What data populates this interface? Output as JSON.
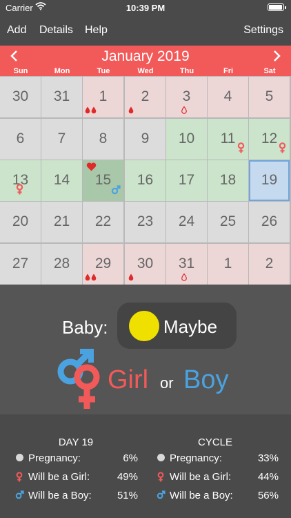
{
  "status_bar": {
    "carrier": "Carrier",
    "time": "10:39 PM"
  },
  "nav": {
    "add": "Add",
    "details": "Details",
    "help": "Help",
    "settings": "Settings"
  },
  "calendar": {
    "month_title": "January 2019",
    "weekdays": [
      "Sun",
      "Mon",
      "Tue",
      "Wed",
      "Thu",
      "Fri",
      "Sat"
    ],
    "days": [
      {
        "n": "30",
        "t": "other"
      },
      {
        "n": "31",
        "t": "other"
      },
      {
        "n": "1",
        "t": "period",
        "flow": 2
      },
      {
        "n": "2",
        "t": "period",
        "flow": 1
      },
      {
        "n": "3",
        "t": "period",
        "flow": "light"
      },
      {
        "n": "4",
        "t": "period"
      },
      {
        "n": "5",
        "t": "period"
      },
      {
        "n": "6",
        "t": "other"
      },
      {
        "n": "7",
        "t": "other"
      },
      {
        "n": "8",
        "t": "other"
      },
      {
        "n": "9",
        "t": "other"
      },
      {
        "n": "10",
        "t": "fertile"
      },
      {
        "n": "11",
        "t": "fertile",
        "sex": "girl"
      },
      {
        "n": "12",
        "t": "fertile",
        "sex": "girl"
      },
      {
        "n": "13",
        "t": "fertile",
        "sex": "girl"
      },
      {
        "n": "14",
        "t": "fertile"
      },
      {
        "n": "15",
        "t": "ovulation",
        "sex": "boy",
        "heart": true
      },
      {
        "n": "16",
        "t": "fertile"
      },
      {
        "n": "17",
        "t": "fertile"
      },
      {
        "n": "18",
        "t": "fertile"
      },
      {
        "n": "19",
        "t": "selected"
      },
      {
        "n": "20",
        "t": "other"
      },
      {
        "n": "21",
        "t": "other"
      },
      {
        "n": "22",
        "t": "other"
      },
      {
        "n": "23",
        "t": "other"
      },
      {
        "n": "24",
        "t": "other"
      },
      {
        "n": "25",
        "t": "other"
      },
      {
        "n": "26",
        "t": "other"
      },
      {
        "n": "27",
        "t": "other"
      },
      {
        "n": "28",
        "t": "other"
      },
      {
        "n": "29",
        "t": "period",
        "flow": 2
      },
      {
        "n": "30",
        "t": "period",
        "flow": 1
      },
      {
        "n": "31",
        "t": "period",
        "flow": "light"
      },
      {
        "n": "1",
        "t": "period"
      },
      {
        "n": "2",
        "t": "period"
      }
    ]
  },
  "baby": {
    "label": "Baby:",
    "value": "Maybe",
    "girl": "Girl",
    "or": "or",
    "boy": "Boy"
  },
  "stats": {
    "day": {
      "title": "DAY 19",
      "rows": [
        {
          "icon": "dot",
          "label": "Pregnancy:",
          "value": "6%"
        },
        {
          "icon": "female",
          "label": "Will be a Girl:",
          "value": "49%"
        },
        {
          "icon": "male",
          "label": "Will be a Boy:",
          "value": "51%"
        }
      ]
    },
    "cycle": {
      "title": "CYCLE",
      "rows": [
        {
          "icon": "dot",
          "label": "Pregnancy:",
          "value": "33%"
        },
        {
          "icon": "female",
          "label": "Will be a Girl:",
          "value": "44%"
        },
        {
          "icon": "male",
          "label": "Will be a Boy:",
          "value": "56%"
        }
      ]
    }
  },
  "colors": {
    "accent": "#f25a5a",
    "girl": "#f25a5a",
    "boy": "#4aa3e0",
    "fertile": "#cbe4cb",
    "period": "#ecd6d6",
    "maybe": "#f0e000"
  }
}
